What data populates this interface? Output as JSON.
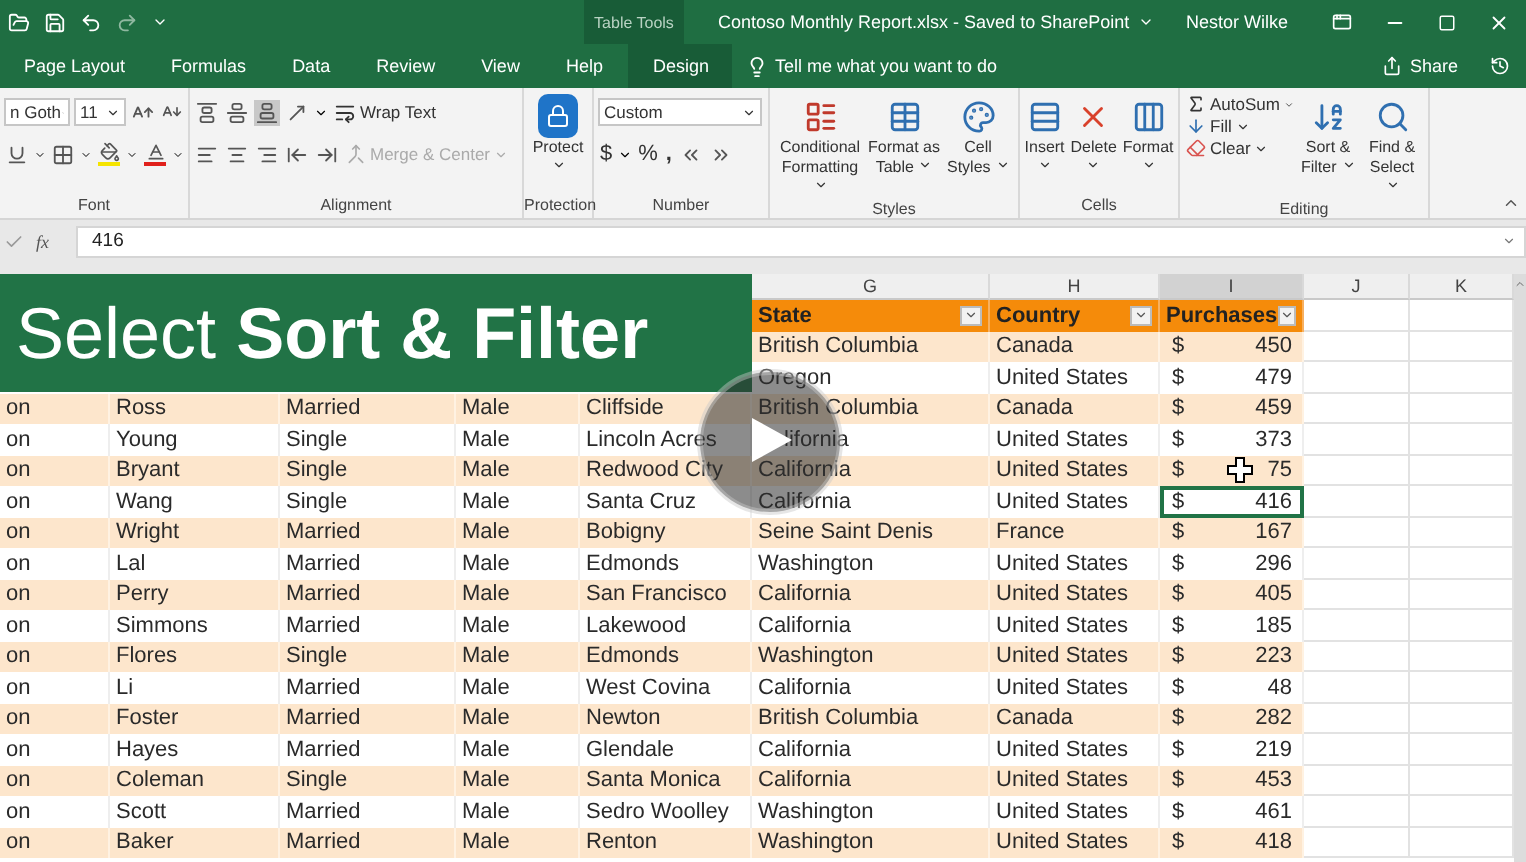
{
  "title_bar": {
    "context_label": "Table Tools",
    "title": "Contoso Monthly Report.xlsx - Saved to SharePoint",
    "user": "Nestor Wilke"
  },
  "ribbon_tabs": [
    {
      "label": "Page Layout",
      "selected": false
    },
    {
      "label": "Formulas",
      "selected": false
    },
    {
      "label": "Data",
      "selected": false
    },
    {
      "label": "Review",
      "selected": false
    },
    {
      "label": "View",
      "selected": false
    },
    {
      "label": "Help",
      "selected": false
    },
    {
      "label": "Design",
      "selected": true
    }
  ],
  "tell_me": {
    "placeholder": "Tell me what you want to do"
  },
  "share": "Share",
  "ribbon": {
    "groups": [
      {
        "kind": "font",
        "label": "Font",
        "font_name": "n Goth",
        "font_size": "11"
      },
      {
        "kind": "alignment",
        "label": "Alignment",
        "vertical_align": [
          {
            "selected": false
          },
          {
            "selected": false
          },
          {
            "selected": true
          }
        ],
        "wrap_text": "Wrap Text",
        "merge": {
          "label": "Merge & Center",
          "disabled": true
        }
      },
      {
        "kind": "protection",
        "label": "Protection",
        "button": "Protect"
      },
      {
        "kind": "number",
        "label": "Number",
        "format": "Custom",
        "symbols": [
          "$",
          "%",
          ","
        ]
      },
      {
        "kind": "large_buttons",
        "label": "Styles",
        "buttons": [
          "Conditional Formatting",
          "Format as Table",
          "Cell Styles"
        ]
      },
      {
        "kind": "large_buttons",
        "label": "Cells",
        "buttons": [
          "Insert",
          "Delete",
          "Format"
        ]
      },
      {
        "kind": "editing",
        "label": "Editing",
        "small_buttons": [
          "AutoSum",
          "Fill",
          "Clear"
        ],
        "buttons": [
          "Sort & Filter",
          "Find & Select"
        ]
      }
    ]
  },
  "formula_bar": {
    "function_label": "fx",
    "value": "416"
  },
  "overlay": {
    "title": "Select **Sort & Filter**"
  },
  "sheet": {
    "column_headers": [
      {
        "label": "G",
        "selected": false
      },
      {
        "label": "H",
        "selected": false
      },
      {
        "label": "I",
        "selected": true
      },
      {
        "label": "J",
        "selected": false
      },
      {
        "label": "K",
        "selected": false
      }
    ],
    "table_headers": [
      "State",
      "Country",
      "Purchases"
    ],
    "rows": [
      {
        "cells": [],
        "state": "British Columbia",
        "country": "Canada",
        "currency": "$",
        "purchases": "450",
        "selected": false
      },
      {
        "cells": [],
        "state": "Oregon",
        "country": "United States",
        "currency": "$",
        "purchases": "479",
        "selected": false
      },
      {
        "cells": [
          "on",
          "Ross",
          "Married",
          "Male",
          "Cliffside"
        ],
        "state": "British Columbia",
        "country": "Canada",
        "currency": "$",
        "purchases": "459",
        "selected": false
      },
      {
        "cells": [
          "on",
          "Young",
          "Single",
          "Male",
          "Lincoln Acres"
        ],
        "state": "lifornia",
        "state_covered": true,
        "country": "United States",
        "currency": "$",
        "purchases": "373",
        "selected": false
      },
      {
        "cells": [
          "on",
          "Bryant",
          "Single",
          "Male",
          "Redwood City"
        ],
        "state": "California",
        "country": "United States",
        "currency": "$",
        "purchases": "75",
        "selected": false
      },
      {
        "cells": [
          "on",
          "Wang",
          "Single",
          "Male",
          "Santa Cruz"
        ],
        "state": "California",
        "country": "United States",
        "currency": "$",
        "purchases": "416",
        "selected": true
      },
      {
        "cells": [
          "on",
          "Wright",
          "Married",
          "Male",
          "Bobigny"
        ],
        "state": "Seine Saint Denis",
        "country": "France",
        "currency": "$",
        "purchases": "167",
        "selected": false
      },
      {
        "cells": [
          "on",
          "Lal",
          "Married",
          "Male",
          "Edmonds"
        ],
        "state": "Washington",
        "country": "United States",
        "currency": "$",
        "purchases": "296",
        "selected": false
      },
      {
        "cells": [
          "on",
          "Perry",
          "Married",
          "Male",
          "San Francisco"
        ],
        "state": "California",
        "country": "United States",
        "currency": "$",
        "purchases": "405",
        "selected": false
      },
      {
        "cells": [
          "on",
          "Simmons",
          "Married",
          "Male",
          "Lakewood"
        ],
        "state": "California",
        "country": "United States",
        "currency": "$",
        "purchases": "185",
        "selected": false
      },
      {
        "cells": [
          "on",
          "Flores",
          "Single",
          "Male",
          "Edmonds"
        ],
        "state": "Washington",
        "country": "United States",
        "currency": "$",
        "purchases": "223",
        "selected": false
      },
      {
        "cells": [
          "on",
          "Li",
          "Married",
          "Male",
          "West Covina"
        ],
        "state": "California",
        "country": "United States",
        "currency": "$",
        "purchases": "48",
        "selected": false
      },
      {
        "cells": [
          "on",
          "Foster",
          "Married",
          "Male",
          "Newton"
        ],
        "state": "British Columbia",
        "country": "Canada",
        "currency": "$",
        "purchases": "282",
        "selected": false
      },
      {
        "cells": [
          "on",
          "Hayes",
          "Married",
          "Male",
          "Glendale"
        ],
        "state": "California",
        "country": "United States",
        "currency": "$",
        "purchases": "219",
        "selected": false
      },
      {
        "cells": [
          "on",
          "Coleman",
          "Single",
          "Male",
          "Santa Monica"
        ],
        "state": "California",
        "country": "United States",
        "currency": "$",
        "purchases": "453",
        "selected": false
      },
      {
        "cells": [
          "on",
          "Scott",
          "Married",
          "Male",
          "Sedro Woolley"
        ],
        "state": "Washington",
        "country": "United States",
        "currency": "$",
        "purchases": "461",
        "selected": false
      },
      {
        "cells": [
          "on",
          "Baker",
          "Married",
          "Male",
          "Renton"
        ],
        "state": "Washington",
        "country": "United States",
        "currency": "$",
        "purchases": "418",
        "selected": false
      }
    ]
  }
}
